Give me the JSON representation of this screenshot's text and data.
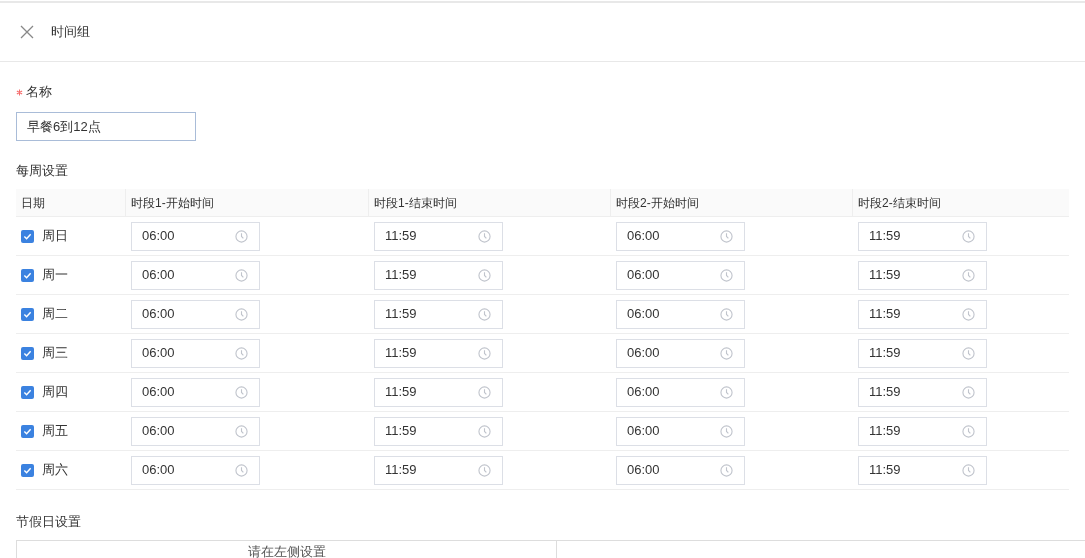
{
  "header": {
    "title": "时间组"
  },
  "name_field": {
    "label": "名称",
    "required": true,
    "value": "早餐6到12点"
  },
  "weekly": {
    "title": "每周设置",
    "columns": [
      "日期",
      "时段1-开始时间",
      "时段1-结束时间",
      "时段2-开始时间",
      "时段2-结束时间"
    ],
    "rows": [
      {
        "day": "周日",
        "checked": true,
        "times": [
          "06:00",
          "11:59",
          "06:00",
          "11:59"
        ]
      },
      {
        "day": "周一",
        "checked": true,
        "times": [
          "06:00",
          "11:59",
          "06:00",
          "11:59"
        ]
      },
      {
        "day": "周二",
        "checked": true,
        "times": [
          "06:00",
          "11:59",
          "06:00",
          "11:59"
        ]
      },
      {
        "day": "周三",
        "checked": true,
        "times": [
          "06:00",
          "11:59",
          "06:00",
          "11:59"
        ]
      },
      {
        "day": "周四",
        "checked": true,
        "times": [
          "06:00",
          "11:59",
          "06:00",
          "11:59"
        ]
      },
      {
        "day": "周五",
        "checked": true,
        "times": [
          "06:00",
          "11:59",
          "06:00",
          "11:59"
        ]
      },
      {
        "day": "周六",
        "checked": true,
        "times": [
          "06:00",
          "11:59",
          "06:00",
          "11:59"
        ]
      }
    ]
  },
  "holiday": {
    "title": "节假日设置",
    "left_hint": "请在左侧设置"
  }
}
